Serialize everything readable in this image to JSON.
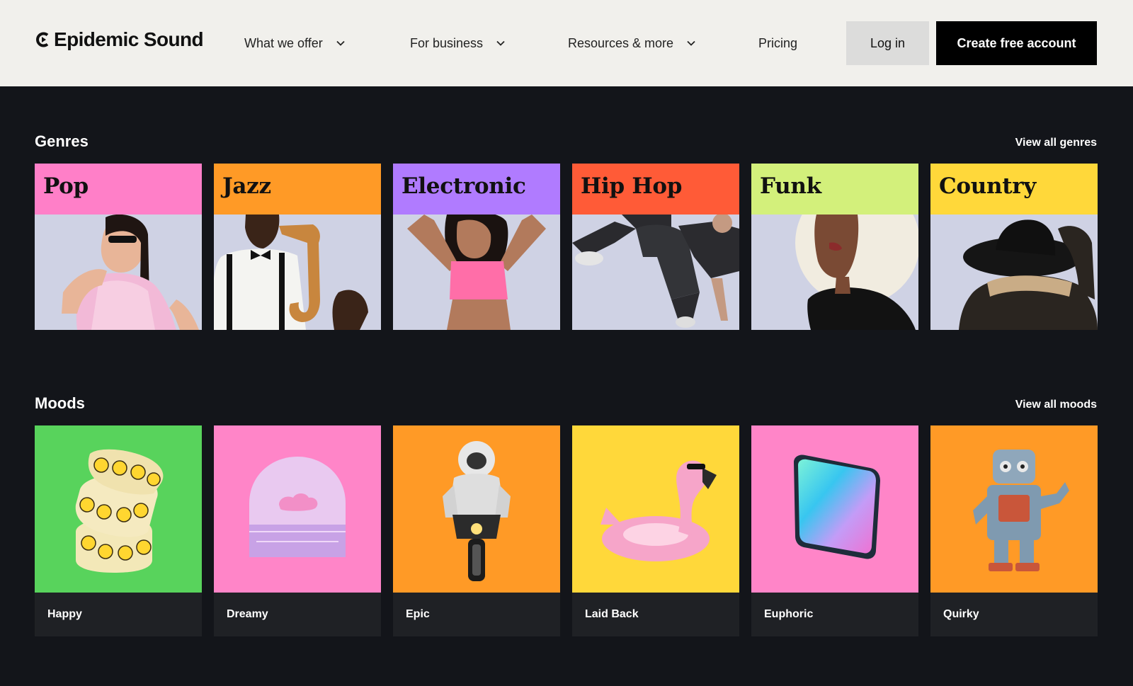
{
  "header": {
    "logo_text": "Epidemic Sound",
    "nav": [
      {
        "label": "What we offer"
      },
      {
        "label": "For business"
      },
      {
        "label": "Resources & more"
      },
      {
        "label": "Pricing"
      }
    ],
    "login_label": "Log in",
    "create_label": "Create free account"
  },
  "genres": {
    "title": "Genres",
    "view_all": "View all genres",
    "items": [
      {
        "label": "Pop",
        "color": "#ff7fc8"
      },
      {
        "label": "Jazz",
        "color": "#ff9a26"
      },
      {
        "label": "Electronic",
        "color": "#b07bff"
      },
      {
        "label": "Hip Hop",
        "color": "#ff5b37"
      },
      {
        "label": "Funk",
        "color": "#d3f07b"
      },
      {
        "label": "Country",
        "color": "#ffd83a"
      }
    ]
  },
  "moods": {
    "title": "Moods",
    "view_all": "View all moods",
    "items": [
      {
        "label": "Happy",
        "color": "#58d35c",
        "icon": "smiley-sticker-roll-icon"
      },
      {
        "label": "Dreamy",
        "color": "#ff85c8",
        "icon": "cloud-arch-icon"
      },
      {
        "label": "Epic",
        "color": "#ff9a26",
        "icon": "astronaut-motorcycle-icon"
      },
      {
        "label": "Laid Back",
        "color": "#ffd83a",
        "icon": "flamingo-float-icon"
      },
      {
        "label": "Euphoric",
        "color": "#ff85c8",
        "icon": "holographic-tile-icon"
      },
      {
        "label": "Quirky",
        "color": "#ff9a26",
        "icon": "toy-robot-icon"
      }
    ]
  }
}
